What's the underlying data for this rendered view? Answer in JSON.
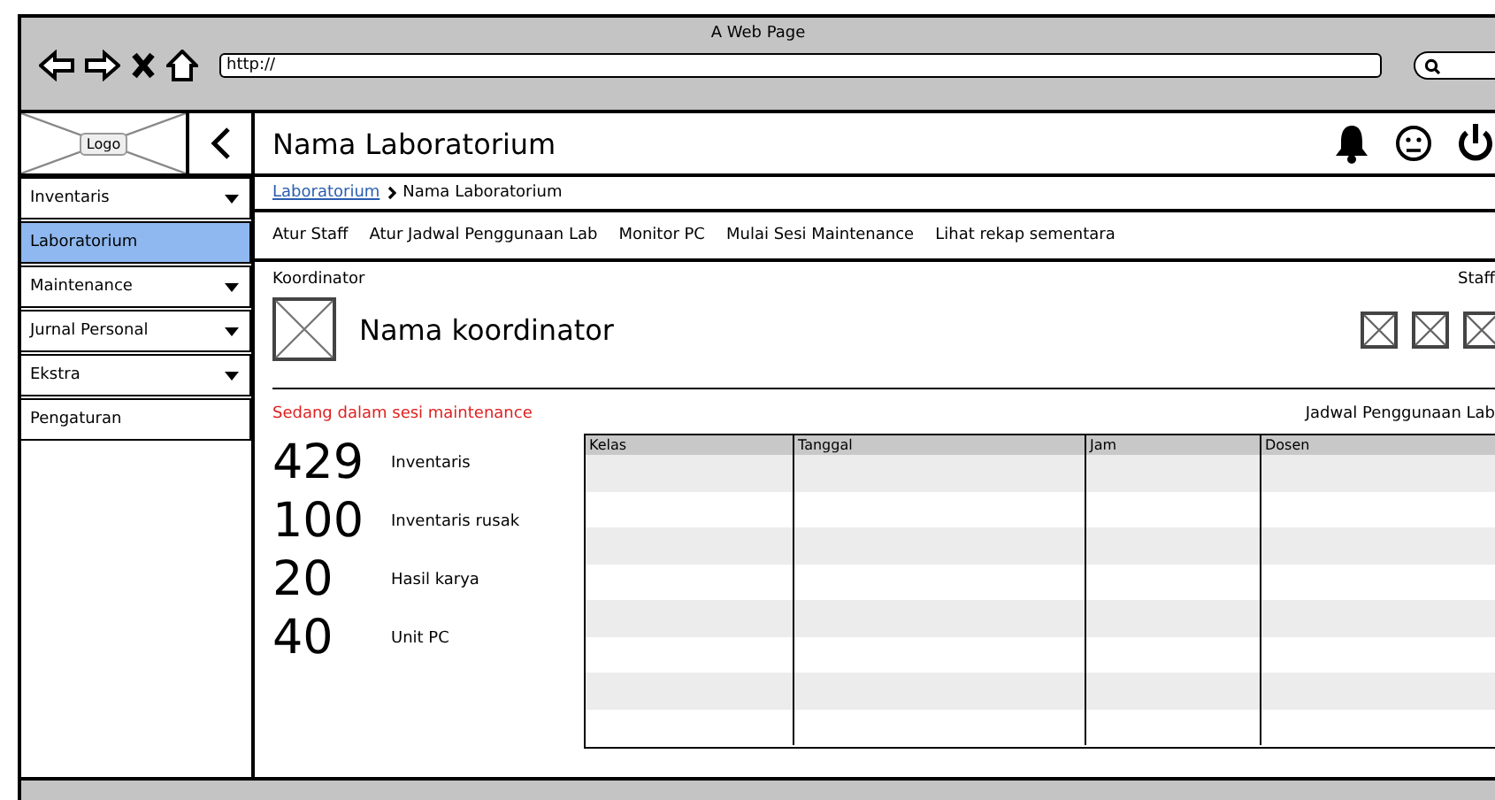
{
  "window": {
    "title": "A Web Page",
    "address": "http://"
  },
  "logo": {
    "label": "Logo"
  },
  "header": {
    "title": "Nama Laboratorium"
  },
  "sidebar": {
    "items": [
      {
        "label": "Inventaris",
        "has_dropdown": true,
        "selected": false
      },
      {
        "label": "Laboratorium",
        "has_dropdown": false,
        "selected": true
      },
      {
        "label": "Maintenance",
        "has_dropdown": true,
        "selected": false
      },
      {
        "label": "Jurnal Personal",
        "has_dropdown": true,
        "selected": false
      },
      {
        "label": "Ekstra",
        "has_dropdown": true,
        "selected": false
      },
      {
        "label": "Pengaturan",
        "has_dropdown": false,
        "selected": false
      }
    ]
  },
  "breadcrumb": [
    {
      "label": "Laboratorium",
      "kind": "link"
    },
    {
      "label": "Nama Laboratorium",
      "kind": "current"
    }
  ],
  "tabs": [
    "Atur Staff",
    "Atur Jadwal Penggunaan Lab",
    "Monitor PC",
    "Mulai Sesi Maintenance",
    "Lihat rekap sementara"
  ],
  "koordinator": {
    "label": "Koordinator",
    "name": "Nama koordinator"
  },
  "staff": {
    "label": "Staff",
    "members": [
      {
        "kind": "image-placeholder"
      },
      {
        "kind": "image-placeholder"
      },
      {
        "kind": "image-placeholder"
      }
    ]
  },
  "status": {
    "text": "Sedang dalam sesi maintenance"
  },
  "stats": [
    {
      "value": "429",
      "label": "Inventaris"
    },
    {
      "value": "100",
      "label": "Inventaris rusak"
    },
    {
      "value": "20",
      "label": "Hasil karya"
    },
    {
      "value": "40",
      "label": "Unit PC"
    }
  ],
  "table": {
    "title": "Jadwal Penggunaan Lab",
    "columns": [
      "Kelas",
      "Tanggal",
      "Jam",
      "Dosen"
    ]
  }
}
